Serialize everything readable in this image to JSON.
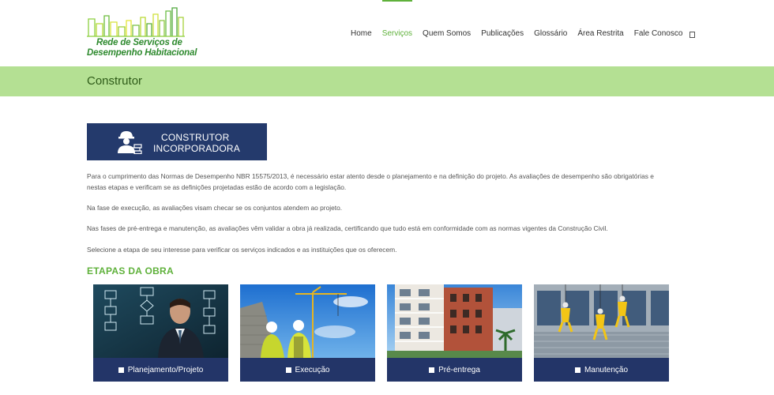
{
  "logo": {
    "line1": "Rede de Serviços de",
    "line2": "Desempenho Habitacional"
  },
  "nav": {
    "items": [
      "Home",
      "Serviços",
      "Quem Somos",
      "Publicações",
      "Glossário",
      "Área Restrita",
      "Fale Conosco"
    ],
    "active_index": 1,
    "search_icon": "search-icon"
  },
  "page": {
    "title": "Construtor"
  },
  "banner": {
    "line1": "CONSTRUTOR",
    "line2": "INCORPORADORA",
    "icon": "worker-icon"
  },
  "content": {
    "p1": "Para o cumprimento das Normas de Desempenho NBR 15575/2013, é necessário estar atento desde o planejamento e na definição do projeto. As avaliações de desempenho são obrigatórias e nestas etapas e verificam se as definições projetadas estão de acordo com a legislação.",
    "p2": "Na fase de execução, as avaliações visam checar se os conjuntos atendem ao projeto.",
    "p3": "Nas fases de pré-entrega e manutenção, as avaliações vêm validar a obra já realizada, certificando que tudo está em conformidade com as normas vigentes da Construção Civil.",
    "p4": "Selecione a etapa de seu interesse para verificar os serviços indicados e as instituições que os oferecem."
  },
  "section": {
    "title": "ETAPAS DA OBRA"
  },
  "cards": [
    {
      "label": "Planejamento/Projeto"
    },
    {
      "label": "Execução"
    },
    {
      "label": "Pré-entrega"
    },
    {
      "label": "Manutenção"
    }
  ],
  "colors": {
    "accent_green": "#5fb13b",
    "title_bar": "#b4e093",
    "navy": "#233568"
  }
}
